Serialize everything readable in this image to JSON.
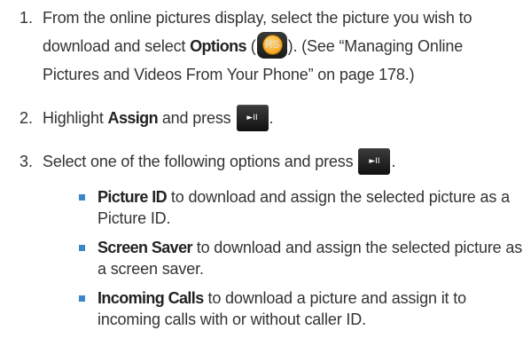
{
  "steps": [
    {
      "number": "1.",
      "lines": [
        {
          "pre": "From the online pictures display, select the picture you wish to"
        },
        {
          "pre": "download and select ",
          "bold": "Options",
          "mid": " (",
          "icon": "RS",
          "post": "). (See “Managing Online"
        },
        {
          "pre": "Pictures and Videos From Your Phone” on page 178.)"
        }
      ]
    },
    {
      "number": "2.",
      "pre": "Highlight ",
      "bold": "Assign",
      "post": " and press",
      "key_glyph": "►II",
      "end": "."
    },
    {
      "number": "3.",
      "pre": "Select one of the following options and press",
      "key_glyph": "►II",
      "end": "."
    }
  ],
  "bullets": [
    {
      "bold": "Picture ID",
      "lines": [
        " to download and assign the selected picture as a",
        "Picture ID."
      ]
    },
    {
      "bold": "Screen Saver",
      "lines": [
        " to download and assign the selected picture as",
        "a screen saver."
      ]
    },
    {
      "bold": "Incoming Calls",
      "lines": [
        " to download a picture and assign it to",
        "incoming calls with or without caller ID."
      ]
    }
  ],
  "icons": {
    "options_key": "rs-softkey-icon",
    "play_key": "play-pause-key-icon"
  },
  "colors": {
    "text": "#333333",
    "bullet": "#3a86c8",
    "rs_circle": "#f5a623"
  }
}
